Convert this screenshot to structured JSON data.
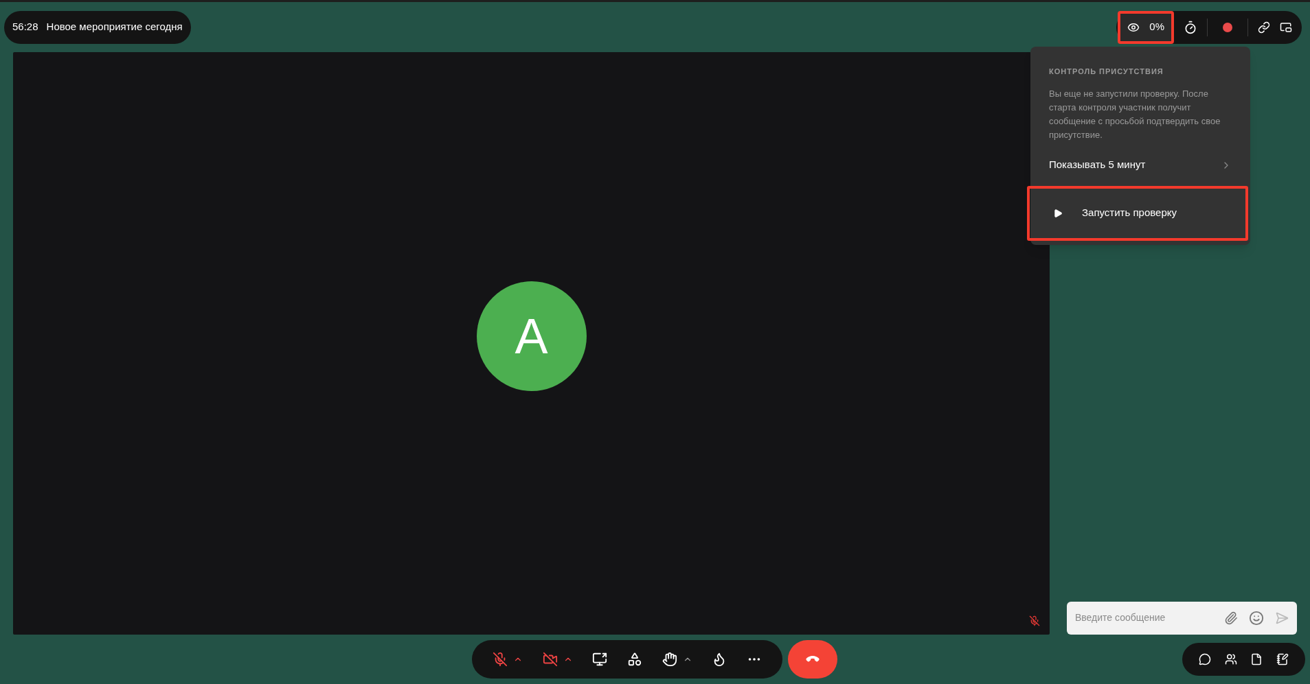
{
  "meeting": {
    "timer": "56:28",
    "title": "Новое мероприятие сегодня"
  },
  "top_toolbar": {
    "presence_reading": "0%",
    "highlighted": true,
    "recording": true
  },
  "presence_popover": {
    "heading": "КОНТРОЛЬ ПРИСУТСТВИЯ",
    "description": "Вы еще не запустили проверку. После старта контроля участник получит сообщение с просьбой подтвердить свое присутствие.",
    "duration_option": "Показывать 5 минут",
    "start_button": {
      "label": "Запустить проверку",
      "highlighted": true
    }
  },
  "video_tile": {
    "avatar_initial": "A",
    "muted": true
  },
  "controls": [
    {
      "kind": "mic",
      "off": true,
      "menu": true
    },
    {
      "kind": "camera",
      "off": true,
      "menu": true
    },
    {
      "kind": "screen",
      "off": false,
      "menu": false
    },
    {
      "kind": "apps",
      "off": false,
      "menu": false
    },
    {
      "kind": "hand",
      "off": false,
      "menu": true
    },
    {
      "kind": "reaction",
      "off": false,
      "menu": false
    },
    {
      "kind": "more",
      "off": false,
      "menu": false
    }
  ],
  "chat": {
    "placeholder": "Введите сообщение"
  }
}
